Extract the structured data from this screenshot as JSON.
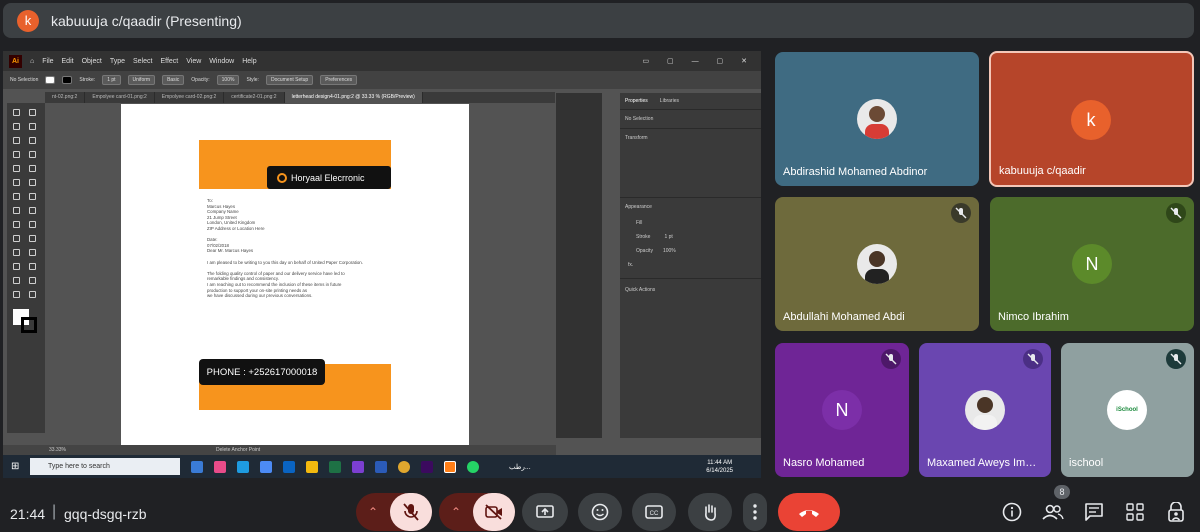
{
  "presenting": {
    "avatar_letter": "k",
    "title": "kabuuuja c/qaadir (Presenting)"
  },
  "screen": {
    "menu": [
      "File",
      "Edit",
      "Object",
      "Type",
      "Select",
      "Effect",
      "View",
      "Window",
      "Help"
    ],
    "app_icon": "Ai",
    "control": {
      "selection": "No Selection",
      "stroke_label": "Stroke:",
      "stroke_value": "1 pt",
      "uniform": "Uniform",
      "basic": "Basic",
      "opacity_label": "Opacity:",
      "opacity_value": "100%",
      "style_label": "Style:",
      "doc_setup": "Document Setup",
      "preferences": "Preferences"
    },
    "tabs": [
      "nt-02.png:2",
      "Empolyee card-01.png:2",
      "Empolyee card-02.png:2",
      "certificate2-01.png:2",
      "letterhead design4-01.png:2 @ 33.33 % (RGB/Preview)"
    ],
    "letterhead": {
      "company": "Horyaal Elecrronic",
      "letter_lines": "To:\nMarcus Hayes\nCompany Name\n21 Jump Street\nLondon, United Kingdom\nZIP Address or Location Here\n\nDate:\n07/02/2018\nDear Mr. Marcus Hayes\n\nI am pleased to be writing to you this day on behalf of United Paper Corporation.\n\nThe folding quality control of paper and our delivery service have led to\nremarkable findings and consistency.\nI am reaching out to recommend the inclusion of these items in future\nproduction to support your on-site printing needs as\nwe have discussed during our previous conversations.",
      "phone": "PHONE : +252617000018"
    },
    "panel": {
      "tab_properties": "Properties",
      "tab_libraries": "Libraries",
      "no_selection": "No Selection",
      "transform": "Transform",
      "appearance": "Appearance",
      "fill": "Fill",
      "stroke": "Stroke",
      "stroke_value": "1 pt",
      "opacity": "Opacity",
      "opacity_value": "100%",
      "fx": "fx.",
      "quick_actions": "Quick Actions"
    },
    "status": {
      "zoom": "33.33%",
      "tool": "Delete Anchor Point"
    },
    "taskbar": {
      "search": "Type here to search",
      "time": "11:44 AM",
      "date": "6/14/2025",
      "lang": "رطب..."
    }
  },
  "tiles": [
    {
      "name": "Abdirashid Mohamed Abdinor",
      "kind": "photo",
      "bg": "#3f6b82",
      "muted": false
    },
    {
      "name": "kabuuuja c/qaadir",
      "kind": "letter",
      "letter": "k",
      "bg": "#b6452a",
      "avatar_color": "#e8612c",
      "muted": false
    },
    {
      "name": "Abdullahi Mohamed Abdi",
      "kind": "photo",
      "bg": "#6e6a3c",
      "muted": true
    },
    {
      "name": "Nimco Ibrahim",
      "kind": "letter",
      "letter": "N",
      "bg": "#4c6b2b",
      "avatar_color": "#5c8a2a",
      "muted": true
    },
    {
      "name": "Nasro Mohamed",
      "kind": "letter",
      "letter": "N",
      "bg": "#6f2596",
      "avatar_color": "#7c2fa8",
      "muted": true
    },
    {
      "name": "Maxamed Aweys Im…",
      "kind": "photo",
      "bg": "#6a46b0",
      "muted": true
    },
    {
      "name": "ischool",
      "kind": "logo",
      "logo_text": "iSchool",
      "bg": "#8fa0a0",
      "muted": true
    }
  ],
  "bottom": {
    "time": "21:44",
    "separator": "|",
    "meeting_code": "gqq-dsgq-rzb",
    "participants_count": "8"
  },
  "colors": {
    "mic_off_bg": "#f9dedc",
    "red": "#ea4335",
    "dark_red": "#5c1e19",
    "control_bg": "#3c4043"
  }
}
